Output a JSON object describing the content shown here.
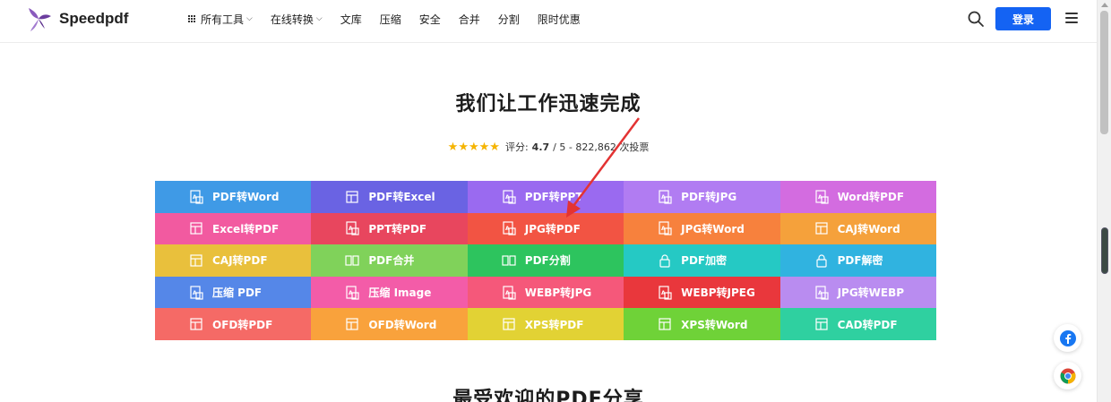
{
  "brand": {
    "name": "Speedpdf"
  },
  "nav": {
    "items": [
      {
        "label": "所有工具",
        "dropdown": true,
        "grid": true
      },
      {
        "label": "在线转换",
        "dropdown": true
      },
      {
        "label": "文库"
      },
      {
        "label": "压缩"
      },
      {
        "label": "安全"
      },
      {
        "label": "合并"
      },
      {
        "label": "分割"
      },
      {
        "label": "限时优惠"
      }
    ],
    "login_label": "登录"
  },
  "hero": {
    "title": "我们让工作迅速完成",
    "rating_prefix": "评分:",
    "rating_value": "4.7",
    "rating_rest": "/ 5 - 822,862 次投票",
    "stars": "★★★★★"
  },
  "tools": [
    {
      "label": "PDF转Word",
      "color": "#3f9ae6"
    },
    {
      "label": "PDF转Excel",
      "color": "#6a63e3"
    },
    {
      "label": "PDF转PPT",
      "color": "#9a6af0"
    },
    {
      "label": "PDF转JPG",
      "color": "#b17cf2"
    },
    {
      "label": "Word转PDF",
      "color": "#d36ce0"
    },
    {
      "label": "Excel转PDF",
      "color": "#f25aa0"
    },
    {
      "label": "PPT转PDF",
      "color": "#e8465e"
    },
    {
      "label": "JPG转PDF",
      "color": "#f25443"
    },
    {
      "label": "JPG转Word",
      "color": "#f7813d"
    },
    {
      "label": "CAJ转Word",
      "color": "#f5a13b"
    },
    {
      "label": "CAJ转PDF",
      "color": "#e9c03c"
    },
    {
      "label": "PDF合并",
      "color": "#80d25a"
    },
    {
      "label": "PDF分割",
      "color": "#2dc45e"
    },
    {
      "label": "PDF加密",
      "color": "#25c9c4"
    },
    {
      "label": "PDF解密",
      "color": "#30b3e0"
    },
    {
      "label": "压缩 PDF",
      "color": "#5587e8"
    },
    {
      "label": "压缩 Image",
      "color": "#f35ca8"
    },
    {
      "label": "WEBP转JPG",
      "color": "#f5587a"
    },
    {
      "label": "WEBP转JPEG",
      "color": "#e9373c"
    },
    {
      "label": "JPG转WEBP",
      "color": "#b98cf0"
    },
    {
      "label": "OFD转PDF",
      "color": "#f56a66"
    },
    {
      "label": "OFD转Word",
      "color": "#f9a23c"
    },
    {
      "label": "XPS转PDF",
      "color": "#e2d234"
    },
    {
      "label": "XPS转Word",
      "color": "#6fd238"
    },
    {
      "label": "CAD转PDF",
      "color": "#2fd0a0"
    }
  ],
  "section2": {
    "title": "最受欢迎的PDF分享"
  },
  "colors": {
    "primary": "#1463f3",
    "arrow": "#e33333",
    "logo": "#7a4ea8"
  }
}
